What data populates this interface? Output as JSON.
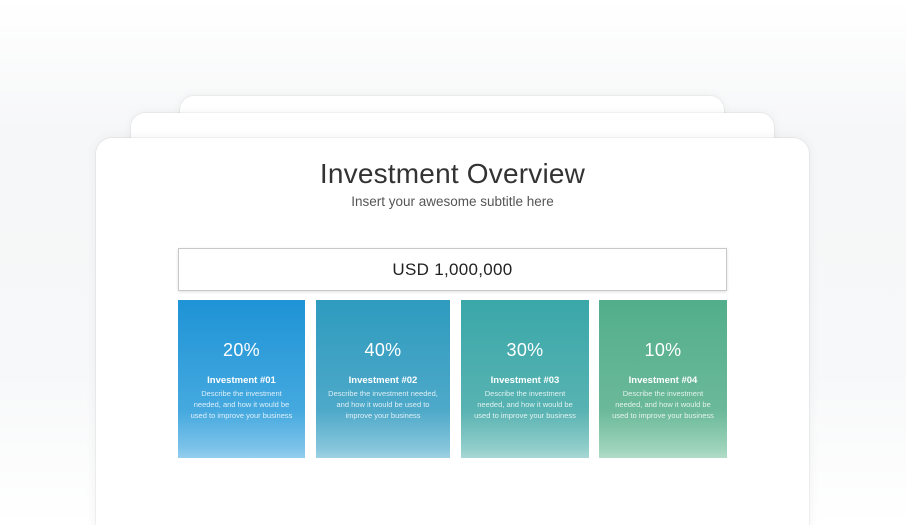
{
  "slide": {
    "title": "Investment Overview",
    "subtitle": "Insert your awesome subtitle here",
    "total": "USD 1,000,000"
  },
  "investments": [
    {
      "percent": "20%",
      "name": "Investment #01",
      "description": "Describe the investment needed, and how it would be used to improve your business",
      "color": "#1e93d6"
    },
    {
      "percent": "40%",
      "name": "Investment #02",
      "description": "Describe the investment needed, and how it would be used to improve your business",
      "color": "#2e9bbf"
    },
    {
      "percent": "30%",
      "name": "Investment #03",
      "description": "Describe the investment needed, and how it would be used to improve your business",
      "color": "#3aa7a9"
    },
    {
      "percent": "10%",
      "name": "Investment #04",
      "description": "Describe the investment needed, and how it would be used to improve your business",
      "color": "#52ae8b"
    }
  ]
}
